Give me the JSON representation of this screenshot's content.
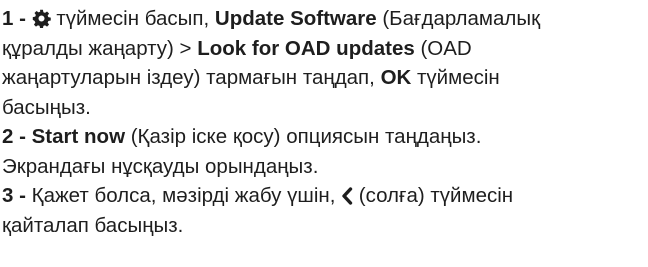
{
  "steps": [
    {
      "number": "1",
      "sep": " - ",
      "gear_icon": "gear-icon",
      "t1": " түймесін басып, ",
      "b1": "Update Software",
      "t2": " (Бағдарламалық",
      "t3": "құралды жаңарту) > ",
      "b2": "Look for OAD updates",
      "t4": " (OAD",
      "t5": "жаңартуларын іздеу) тармағын таңдап, ",
      "b3": "OK",
      "t6": " түймесін",
      "t7": "басыңыз."
    },
    {
      "number": "2",
      "sep": " - ",
      "b1": "Start now",
      "t1": " (Қазір іске қосу) опциясын таңдаңыз.",
      "t2": "Экрандағы нұсқауды орындаңыз."
    },
    {
      "number": "3",
      "sep": " - ",
      "t1": "Қажет болса, мәзірді жабу үшін, ",
      "chevron_icon": "chevron-left-icon",
      "t2": " (солға) түймесін",
      "t3": "қайталап басыңыз."
    }
  ]
}
